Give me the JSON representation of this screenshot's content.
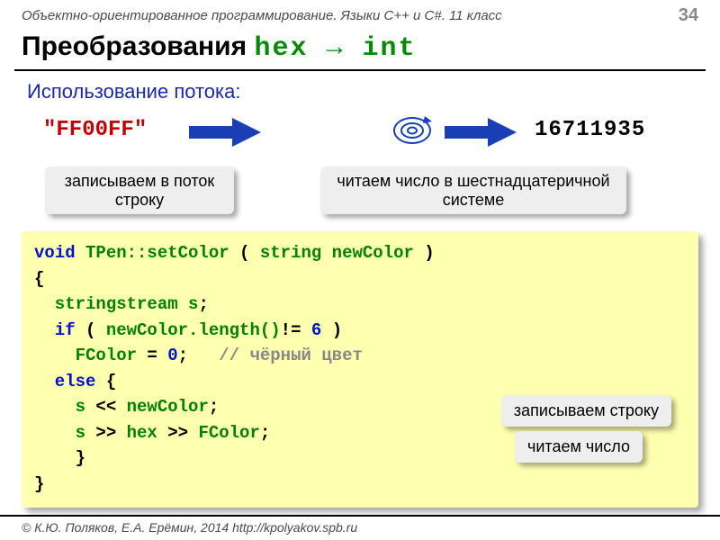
{
  "header": {
    "course": "Объектно-ориентированное программирование. Языки C++ и C#. 11 класс",
    "page_number": "34"
  },
  "title": {
    "prefix": "Преобразования ",
    "mono": "hex → int"
  },
  "subtitle": "Использование потока:",
  "example": {
    "hex_string": "\"FF00FF\"",
    "int_value": "16711935"
  },
  "callouts": {
    "write_to_stream": "записываем в поток строку",
    "read_hex": "читаем число в шестнадцатеричной системе",
    "write_string": "записываем строку",
    "read_number": "читаем число"
  },
  "code": {
    "l1a": "void",
    "l1b": " TPen::setColor",
    "l1c": " ( ",
    "l1d": "string newColor",
    "l1e": " )",
    "l2": "{",
    "l3a": "  stringstream s",
    "l3b": ";",
    "l4a": "  if",
    "l4b": " ( ",
    "l4c": "newColor.length()",
    "l4d": "!= ",
    "l4e": "6",
    "l4f": " )",
    "l5a": "    FColor",
    "l5b": " = ",
    "l5c": "0",
    "l5d": ";   ",
    "l5e": "// чёрный цвет",
    "l6a": "  else",
    "l6b": " {",
    "l7a": "    s",
    "l7b": " << ",
    "l7c": "newColor",
    "l7d": ";",
    "l8a": "    s",
    "l8b": " >> ",
    "l8c": "hex",
    "l8d": " >> ",
    "l8e": "FColor",
    "l8f": ";",
    "l9": "    }",
    "l10": "}"
  },
  "footer": "© К.Ю. Поляков, Е.А. Ерёмин, 2014    http://kpolyakov.spb.ru"
}
